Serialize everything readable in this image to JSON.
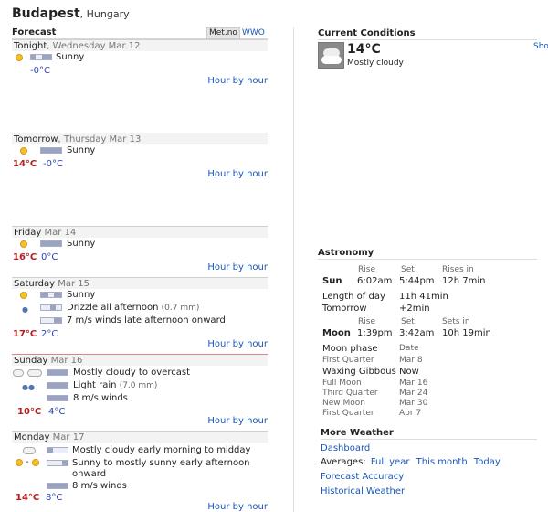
{
  "location": {
    "city": "Budapest",
    "country": ", Hungary"
  },
  "forecast": {
    "heading": "Forecast",
    "sources": [
      "Met.no",
      "WWO"
    ],
    "hour_by_hour": "Hour by hour",
    "days": [
      {
        "day": "Tonight",
        "date": ", Wednesday Mar 12",
        "lines": [
          "Sunny"
        ],
        "high": "",
        "low": "-0°C"
      },
      {
        "day": "Tomorrow",
        "date": ", Thursday Mar 13",
        "lines": [
          "Sunny"
        ],
        "high": "14°C",
        "low": "-0°C"
      },
      {
        "day": "Friday",
        "date": " Mar 14",
        "lines": [
          "Sunny"
        ],
        "high": "16°C",
        "low": "0°C"
      },
      {
        "day": "Saturday",
        "date": " Mar 15",
        "lines": [
          "Sunny",
          "Drizzle all afternoon",
          "7 m/s winds late afternoon onward"
        ],
        "rain": "(0.7 mm)",
        "high": "17°C",
        "low": "2°C"
      },
      {
        "day": "Sunday",
        "date": " Mar 16",
        "lines": [
          "Mostly cloudy to overcast",
          "Light rain",
          "8 m/s winds"
        ],
        "rain": "(7.0 mm)",
        "high": "10°C",
        "low": "4°C"
      },
      {
        "day": "Monday",
        "date": " Mar 17",
        "lines": [
          "Mostly cloudy early morning to midday",
          "Sunny to mostly sunny early afternoon",
          "onward",
          "8 m/s winds"
        ],
        "high": "14°C",
        "low": "8°C"
      }
    ]
  },
  "current": {
    "heading": "Current Conditions",
    "show_link": "Sho",
    "temp": "14°C",
    "desc": "Mostly cloudy"
  },
  "astronomy": {
    "heading": "Astronomy",
    "col_rise": "Rise",
    "col_set": "Set",
    "col_rises_in": "Rises in",
    "col_sets_in": "Sets in",
    "sun": {
      "label": "Sun",
      "rise": "6:02am",
      "set": "5:44pm",
      "in": "12h 7min"
    },
    "length_label": "Length of day",
    "length_value": "11h 41min",
    "tomorrow_label": "Tomorrow",
    "tomorrow_value": "+2min",
    "moon": {
      "label": "Moon",
      "rise": "1:39pm",
      "set": "3:42am",
      "in": "10h 19min"
    },
    "phase_label": "Moon phase",
    "date_label": "Date",
    "phases": [
      {
        "name": "First Quarter",
        "date": "Mar 8"
      },
      {
        "name": "Waxing Gibbous",
        "date": "Now"
      },
      {
        "name": "Full Moon",
        "date": "Mar 16"
      },
      {
        "name": "Third Quarter",
        "date": "Mar 24"
      },
      {
        "name": "New Moon",
        "date": "Mar 30"
      },
      {
        "name": "First Quarter",
        "date": "Apr 7"
      }
    ]
  },
  "more_weather": {
    "heading": "More Weather",
    "dashboard": "Dashboard",
    "averages_label": "Averages:",
    "full_year": "Full year",
    "this_month": "This month",
    "today": "Today",
    "accuracy": "Forecast Accuracy",
    "historical": "Historical Weather"
  }
}
